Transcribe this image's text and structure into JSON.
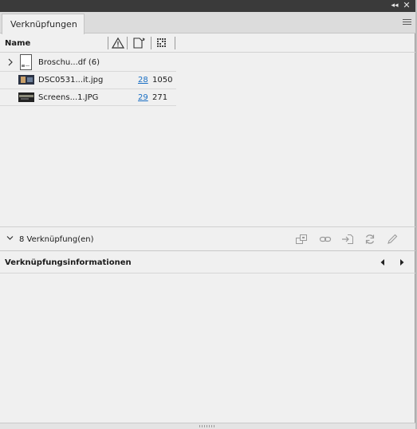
{
  "panel": {
    "tab_title": "Verknüpfungen",
    "collapse_glyph": "◂◂",
    "close_glyph": "✕"
  },
  "columns": {
    "name_label": "Name"
  },
  "rows": [
    {
      "name": "Broschu...df (6)",
      "page": "",
      "size": "",
      "type": "document-group",
      "expanded": false
    },
    {
      "name": "DSC0531...it.jpg",
      "page": "28",
      "size": "1050",
      "type": "image"
    },
    {
      "name": "Screens...1.JPG",
      "page": "29",
      "size": "271",
      "type": "image"
    }
  ],
  "footer": {
    "count_label": "8 Verknüpfung(en)"
  },
  "info": {
    "title": "Verknüpfungsinformationen"
  },
  "colors": {
    "link_blue": "#1a6fc4",
    "panel_bg": "#f0f0f0",
    "titlebar": "#3a3a3a"
  }
}
